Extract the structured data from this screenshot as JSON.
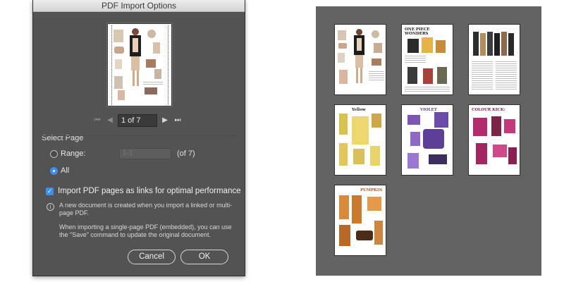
{
  "dialog": {
    "title": "PDF Import Options",
    "navigation": {
      "page_display": "1 of 7",
      "first_icon": "first-page-icon",
      "prev_icon": "previous-page-icon",
      "next_icon": "next-page-icon",
      "last_icon": "last-page-icon"
    },
    "select_page": {
      "title": "Select Page",
      "range_label": "Range:",
      "range_value": "1-1",
      "of_count": "(of 7)",
      "all_label": "All",
      "selected": "All"
    },
    "import_links_label": "Import PDF pages as links for optimal performance",
    "import_links_checked": true,
    "info_paragraph_1": "A new document is created when you import a linked or multi-page PDF.",
    "info_paragraph_2": "When importing a single-page PDF (embedded), you can use the \"Save\" command to update the original document.",
    "cancel_label": "Cancel",
    "ok_label": "OK"
  },
  "pages": [
    {
      "title": ""
    },
    {
      "title": "ONE PIECE WONDERS"
    },
    {
      "title": ""
    },
    {
      "title": "Yellow"
    },
    {
      "title": "VIOLET"
    },
    {
      "title": "COLOUR KICK:"
    },
    {
      "title": "PUMPKIN"
    }
  ],
  "colors": {
    "dialog_bg": "#535353",
    "grid_bg": "#636363",
    "accent": "#3d8ff0"
  }
}
